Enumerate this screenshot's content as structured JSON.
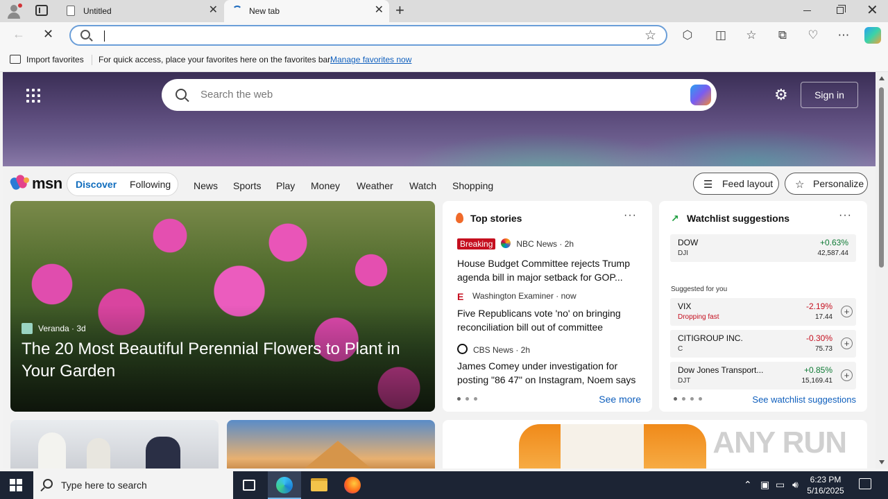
{
  "browser": {
    "tabs": [
      {
        "label": "Untitled"
      },
      {
        "label": "New tab"
      }
    ],
    "favorites_bar": {
      "import_label": "Import favorites",
      "message": "For quick access, place your favorites here on the favorites bar.",
      "link": "Manage favorites now"
    }
  },
  "msn": {
    "search_placeholder": "Search the web",
    "sign_in": "Sign in",
    "brand": "msn",
    "segments": {
      "discover": "Discover",
      "following": "Following"
    },
    "nav": [
      "News",
      "Sports",
      "Play",
      "Money",
      "Weather",
      "Watch",
      "Shopping"
    ],
    "feed_layout": "Feed layout",
    "personalize": "Personalize",
    "feature": {
      "source": "Veranda · 3d",
      "headline": "The 20 Most Beautiful Perennial Flowers to Plant in Your Garden"
    },
    "top_stories": {
      "title": "Top stories",
      "stories": [
        {
          "badge": "Breaking",
          "source": "NBC News · 2h",
          "headline": "House Budget Committee rejects Trump agenda bill in major setback for GOP..."
        },
        {
          "badge": "",
          "source": "Washington Examiner · now",
          "headline": "Five Republicans vote 'no' on bringing reconciliation bill out of committee"
        },
        {
          "badge": "",
          "source": "CBS News · 2h",
          "headline": "James Comey under investigation for posting \"86 47\" on Instagram, Noem says"
        }
      ],
      "see_more": "See more"
    },
    "watchlist": {
      "title": "Watchlist suggestions",
      "main": {
        "name": "DOW",
        "symbol": "DJI",
        "change": "+0.63%",
        "price": "42,587.44"
      },
      "suggested_label": "Suggested for you",
      "suggestions": [
        {
          "name": "VIX",
          "symbol": "",
          "note": "Dropping fast",
          "change": "-2.19%",
          "price": "17.44"
        },
        {
          "name": "CITIGROUP INC.",
          "symbol": "C",
          "note": "",
          "change": "-0.30%",
          "price": "75.73"
        },
        {
          "name": "Dow Jones Transport...",
          "symbol": "DJT",
          "note": "",
          "change": "+0.85%",
          "price": "15,169.41"
        }
      ],
      "see_link": "See watchlist suggestions"
    },
    "watermark": "ANY RUN"
  },
  "taskbar": {
    "search_placeholder": "Type here to search",
    "time": "6:23 PM",
    "date": "5/16/2025"
  },
  "colors": {
    "accent": "#0f6cbd",
    "breaking": "#c50f1f",
    "positive": "#0e7a34",
    "negative": "#c50f1f"
  }
}
